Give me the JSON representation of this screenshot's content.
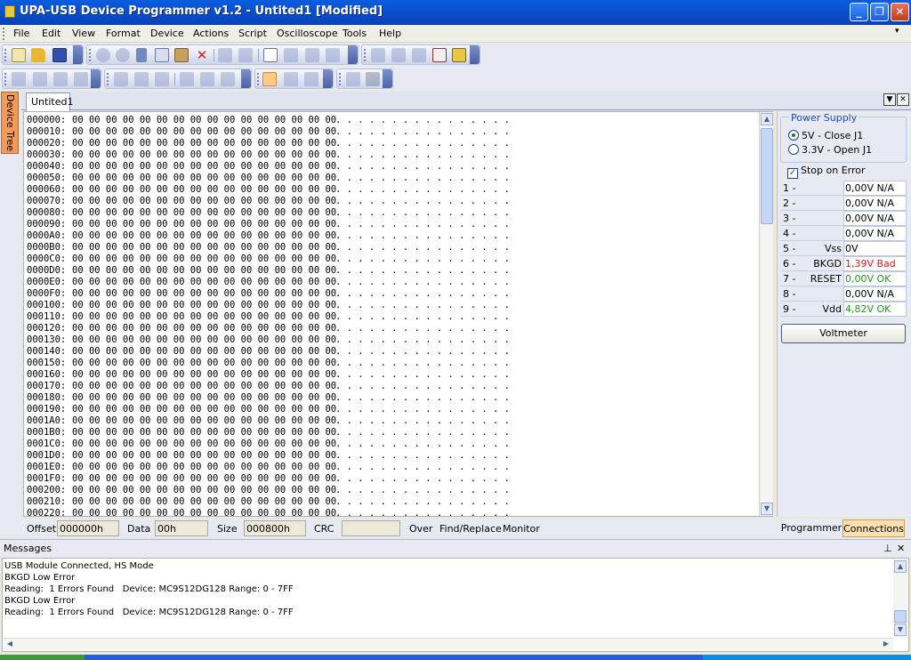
{
  "window": {
    "title": "UPA-USB Device Programmer v1.2 - Untited1 [Modified]",
    "min": "_",
    "max": "❐",
    "close": "✕"
  },
  "menu": [
    "File",
    "Edit",
    "View",
    "Format",
    "Device",
    "Actions",
    "Script",
    "Oscilloscope",
    "Tools",
    "Help"
  ],
  "side_tab": "Device Tree",
  "doc_tab": "Untited1",
  "hex": {
    "rows": [
      "000000:",
      "000010:",
      "000020:",
      "000030:",
      "000040:",
      "000050:",
      "000060:",
      "000070:",
      "000080:",
      "000090:",
      "0000A0:",
      "0000B0:",
      "0000C0:",
      "0000D0:",
      "0000E0:",
      "0000F0:",
      "000100:",
      "000110:",
      "000120:",
      "000130:",
      "000140:",
      "000150:",
      "000160:",
      "000170:",
      "000180:",
      "000190:",
      "0001A0:",
      "0001B0:",
      "0001C0:",
      "0001D0:",
      "0001E0:",
      "0001F0:",
      "000200:",
      "000210:",
      "000220:"
    ],
    "bytes": "00 00 00 00 00 00 00 00 00 00 00 00 00 00 00 00",
    "ascii": ". . . . . . . . . . . . . . . ."
  },
  "status": {
    "offset_label": "Offset",
    "offset_value": "000000h",
    "data_label": "Data",
    "data_value": "00h",
    "size_label": "Size",
    "size_value": "000800h",
    "crc_label": "CRC",
    "crc_value": "",
    "over": "Over",
    "findreplace": "Find/Replace",
    "monitor": "Monitor"
  },
  "power_supply": {
    "legend": "Power Supply",
    "opt1": "5V - Close J1",
    "opt2": "3.3V - Open J1",
    "stop_on_error": "Stop on Error"
  },
  "pins": [
    {
      "num": "1 -",
      "name": "",
      "value": "0,00V",
      "status": "N/A",
      "color": "#000000"
    },
    {
      "num": "2 -",
      "name": "",
      "value": "0,00V",
      "status": "N/A",
      "color": "#000000"
    },
    {
      "num": "3 -",
      "name": "",
      "value": "0,00V",
      "status": "N/A",
      "color": "#000000"
    },
    {
      "num": "4 -",
      "name": "",
      "value": "0,00V",
      "status": "N/A",
      "color": "#000000"
    },
    {
      "num": "5 -",
      "name": "Vss",
      "value": "0V",
      "status": "",
      "color": "#000000"
    },
    {
      "num": "6 -",
      "name": "BKGD",
      "value": "1,39V",
      "status": "Bad",
      "color": "#e01818"
    },
    {
      "num": "7 -",
      "name": "RESET",
      "value": "0,00V",
      "status": "OK",
      "color": "#1a9a1a"
    },
    {
      "num": "8 -",
      "name": "",
      "value": "0,00V",
      "status": "N/A",
      "color": "#000000"
    },
    {
      "num": "9 -",
      "name": "Vdd",
      "value": "4,82V",
      "status": "OK",
      "color": "#1a9a1a"
    }
  ],
  "voltmeter": "Voltmeter",
  "right_tabs": {
    "programmer": "Programmer",
    "connections": "Connections"
  },
  "messages": {
    "title": "Messages",
    "lines": [
      "USB Module Connected, HS Mode",
      "BKGD Low Error",
      "Reading:  1 Errors Found   Device: MC9S12DG128 Range: 0 - 7FF",
      "BKGD Low Error",
      "Reading:  1 Errors Found   Device: MC9S12DG128 Range: 0 - 7FF"
    ]
  },
  "colors": {
    "titlebar": "#0b4fce",
    "accent_tab": "#f29a5a",
    "bad": "#e01818",
    "ok": "#1a9a1a",
    "legend": "#1c46b8"
  }
}
